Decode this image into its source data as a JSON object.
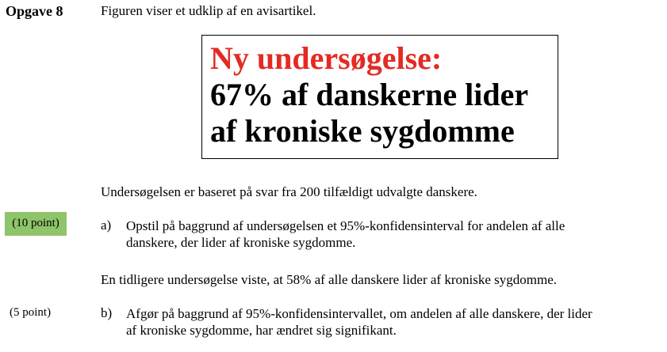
{
  "task": {
    "label": "Opgave 8",
    "intro": "Figuren viser et udklip af en avisartikel."
  },
  "headline": {
    "line1": "Ny undersøgelse:",
    "line2": "67% af danskerne lider",
    "line3": "af kroniske sygdomme",
    "accent_color": "#e32b24"
  },
  "basis_text": "Undersøgelsen er baseret på svar fra 200 tilfældigt udvalgte danskere.",
  "questions": [
    {
      "points": "(10 point)",
      "letter": "a)",
      "line1": "Opstil på baggrund af undersøgelsen et 95%-konfidensinterval for andelen af alle",
      "line2": "danskere, der lider af kroniske sygdomme.",
      "points_badge_color": "#8fc46a"
    },
    {
      "points": "(5 point)",
      "letter": "b)",
      "line1": "Afgør på baggrund af 95%-konfidensintervallet, om andelen af alle danskere, der lider",
      "line2": "af kroniske sygdomme, har ændret sig signifikant."
    }
  ],
  "info_text": "En tidligere undersøgelse viste, at 58% af alle danskere lider af kroniske sygdomme."
}
